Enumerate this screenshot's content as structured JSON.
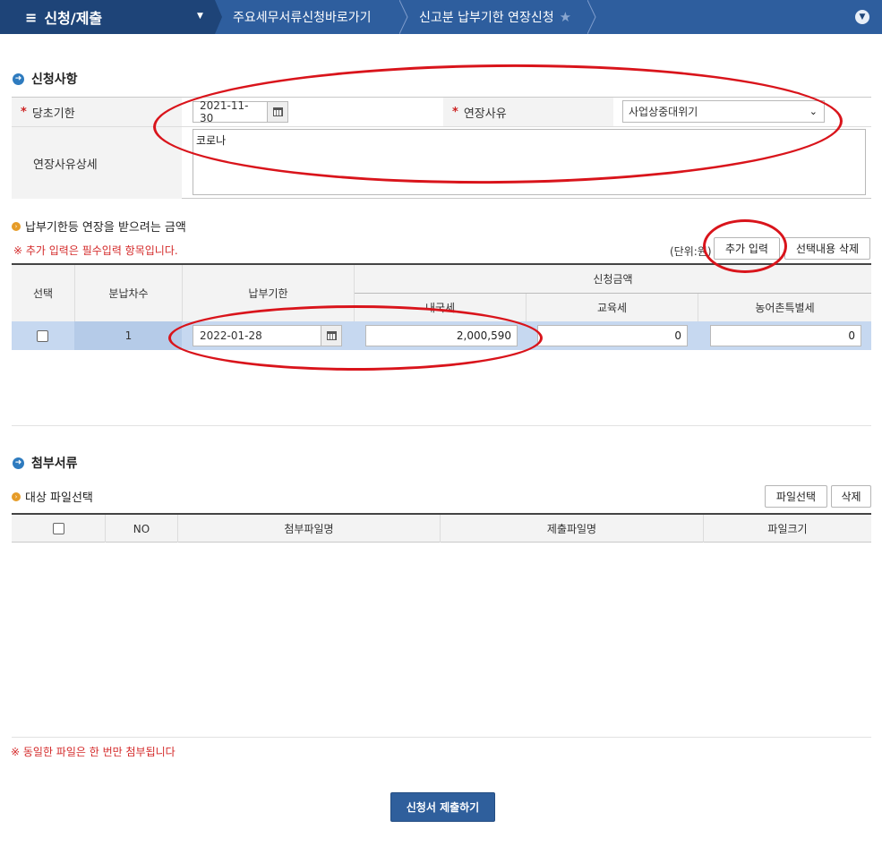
{
  "nav": {
    "menu_title": "신청/제출",
    "breadcrumb_1": "주요세무서류신청바로가기",
    "breadcrumb_2": "신고분 납부기한 연장신청"
  },
  "apply": {
    "section_title": "신청사항",
    "due_label": "당초기한",
    "due_value": "2021-11-30",
    "reason_label": "연장사유",
    "reason_value": "사업상중대위기",
    "detail_label": "연장사유상세",
    "detail_value": "코로나"
  },
  "amount": {
    "subtitle": "납부기한등 연장을 받으려는 금액",
    "note": "※ 추가 입력은 필수입력 항목입니다.",
    "unit": "(단위:원)",
    "add_button": "추가 입력",
    "delete_button": "선택내용 삭제",
    "headers": {
      "select": "선택",
      "installment": "분납차수",
      "due": "납부기한",
      "request_amount": "신청금액",
      "domestic_tax": "내국세",
      "education_tax": "교육세",
      "rural_tax": "농어촌특별세"
    },
    "rows": [
      {
        "installment": "1",
        "due": "2022-01-28",
        "domestic_tax": "2,000,590",
        "education_tax": "0",
        "rural_tax": "0"
      }
    ]
  },
  "attach": {
    "section_title": "첨부서류",
    "subtitle": "대상 파일선택",
    "file_select_button": "파일선택",
    "delete_button": "삭제",
    "headers": {
      "no": "NO",
      "attach_name": "첨부파일명",
      "submit_name": "제출파일명",
      "size": "파일크기"
    },
    "note": "※ 동일한 파일은 한 번만 첨부됩니다"
  },
  "submit_button": "신청서 제출하기"
}
